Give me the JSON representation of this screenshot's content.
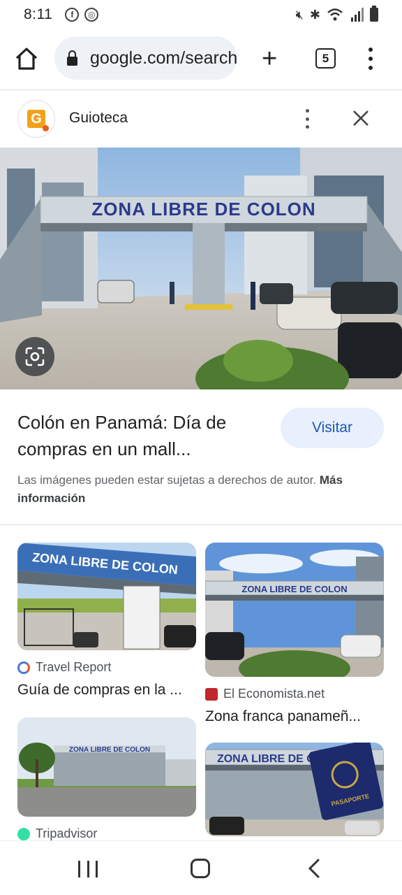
{
  "status_bar": {
    "time": "8:11"
  },
  "browser": {
    "url": "google.com/search",
    "tab_count": "5"
  },
  "site": {
    "name": "Guioteca",
    "logo_letter": "G"
  },
  "hero": {
    "sign_text": "ZONA LIBRE DE COLON"
  },
  "result": {
    "title": "Colón en Panamá: Día de compras en un mall...",
    "visit_label": "Visitar",
    "copyright_text": "Las imágenes pueden estar sujetas a derechos de autor.",
    "more_info": "Más información"
  },
  "related": [
    {
      "source": "Travel Report",
      "title": "Guía de compras en la ...",
      "sign": "ZONA LIBRE DE COLON"
    },
    {
      "source": "El Economista.net",
      "title": "Zona franca panameñ...",
      "sign": "ZONA LIBRE DE COLON"
    },
    {
      "source": "Tripadvisor",
      "title": "",
      "sign": "ZONA LIBRE DE COLON"
    },
    {
      "source": "",
      "title": "",
      "sign": "ZONA LIBRE DE COLON",
      "passport_text": "PASAPORTE"
    }
  ],
  "colors": {
    "accent": "#1a56b8",
    "visit_bg": "#e8f0fe",
    "sign_text": "#2a3a8c"
  }
}
